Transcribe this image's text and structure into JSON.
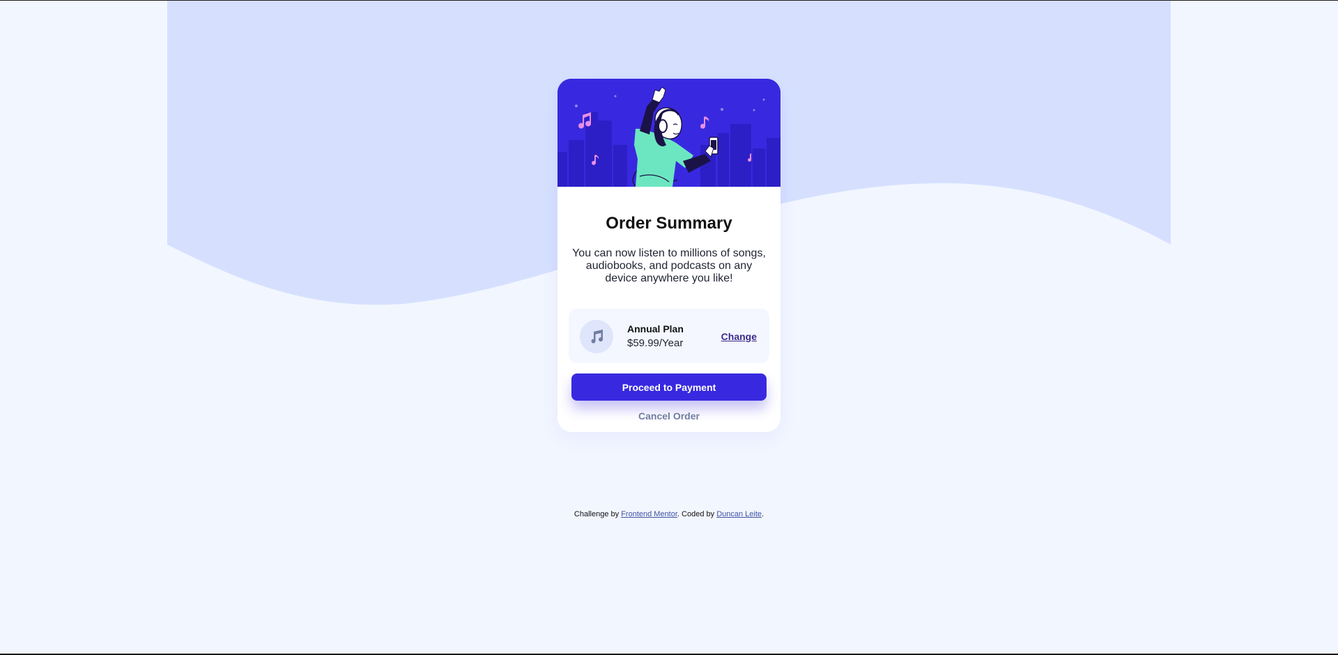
{
  "card": {
    "title": "Order Summary",
    "description": "You can now listen to millions of songs, audiobooks, and podcasts on any device anywhere you like!",
    "plan": {
      "icon": "music-note-icon",
      "name": "Annual Plan",
      "price": "$59.99/Year",
      "change_label": "Change"
    },
    "pay_label": "Proceed to Payment",
    "cancel_label": "Cancel Order"
  },
  "footer": {
    "prefix": "Challenge by ",
    "link1": "Frontend Mentor",
    "middle": ". Coded by ",
    "link2": "Duncan Leite",
    "suffix": "."
  },
  "colors": {
    "page_background": "#f2f6ff",
    "wave": "#d6e0fe",
    "primary": "#3829e0",
    "card": "#ffffff",
    "plan_box": "#f4f7ff",
    "muted": "#717da2",
    "link": "#3e52a3"
  }
}
